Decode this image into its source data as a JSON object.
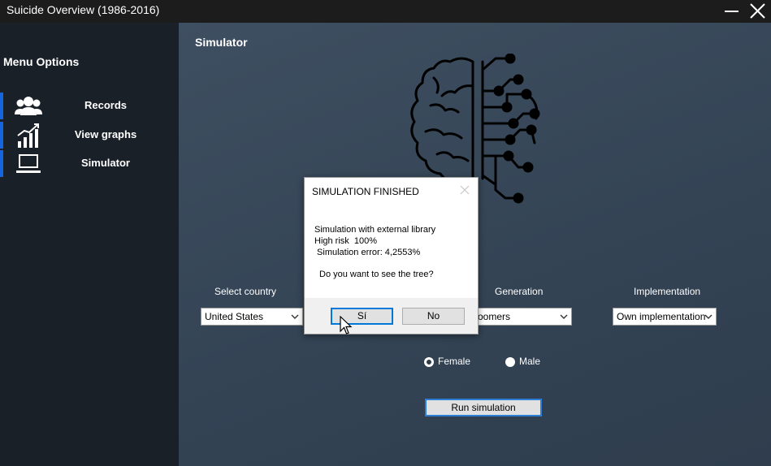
{
  "window": {
    "title": "Suicide Overview (1986-2016)"
  },
  "sidebar": {
    "title": "Menu Options",
    "items": [
      {
        "label": "Records",
        "icon": "users-icon"
      },
      {
        "label": "View graphs",
        "icon": "bar-chart-icon"
      },
      {
        "label": "Simulator",
        "icon": "laptop-icon"
      }
    ],
    "accent_color": "#1565e0"
  },
  "main": {
    "title": "Simulator",
    "fields": {
      "country": {
        "label": "Select country",
        "value": "United States"
      },
      "generation": {
        "label": "Generation",
        "value": "oomers"
      },
      "implementation": {
        "label": "Implementation",
        "value": "Own implementation"
      }
    },
    "sex": {
      "options": [
        "Female",
        "Male"
      ],
      "selected": "Female"
    },
    "run_button": "Run simulation"
  },
  "dialog": {
    "title": "SIMULATION FINISHED",
    "lines": [
      "Simulation with external library",
      "High risk  100%",
      " Simulation error: 4,2553%",
      "Do you want to see the tree?"
    ],
    "yes_label": "Sí",
    "no_label": "No"
  }
}
